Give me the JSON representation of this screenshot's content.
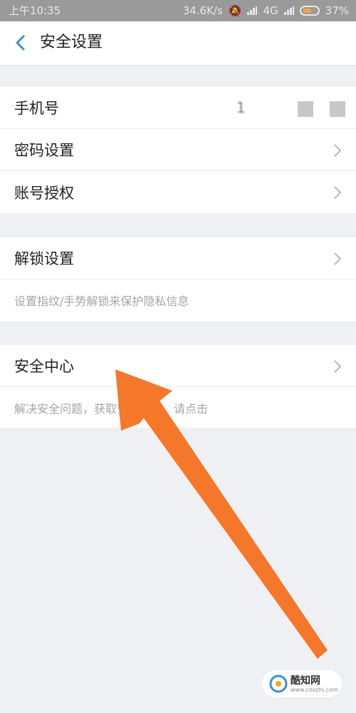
{
  "status_bar": {
    "time": "上午10:35",
    "speed": "34.6K/s",
    "network": "4G",
    "battery": "37%"
  },
  "header": {
    "title": "安全设置"
  },
  "group1": {
    "phone_label": "手机号",
    "phone_value": "1",
    "password_label": "密码设置",
    "auth_label": "账号授权"
  },
  "group2": {
    "unlock_label": "解锁设置",
    "unlock_hint": "设置指纹/手势解锁来保护隐私信息"
  },
  "group3": {
    "security_label": "安全中心",
    "security_hint": "解决安全问题，获取安全资讯，请点击"
  },
  "watermark": {
    "name": "酷知网",
    "url": "www.coozhi.com"
  },
  "colors": {
    "accent": "#3a8fd6",
    "arrow": "#f5782a"
  }
}
